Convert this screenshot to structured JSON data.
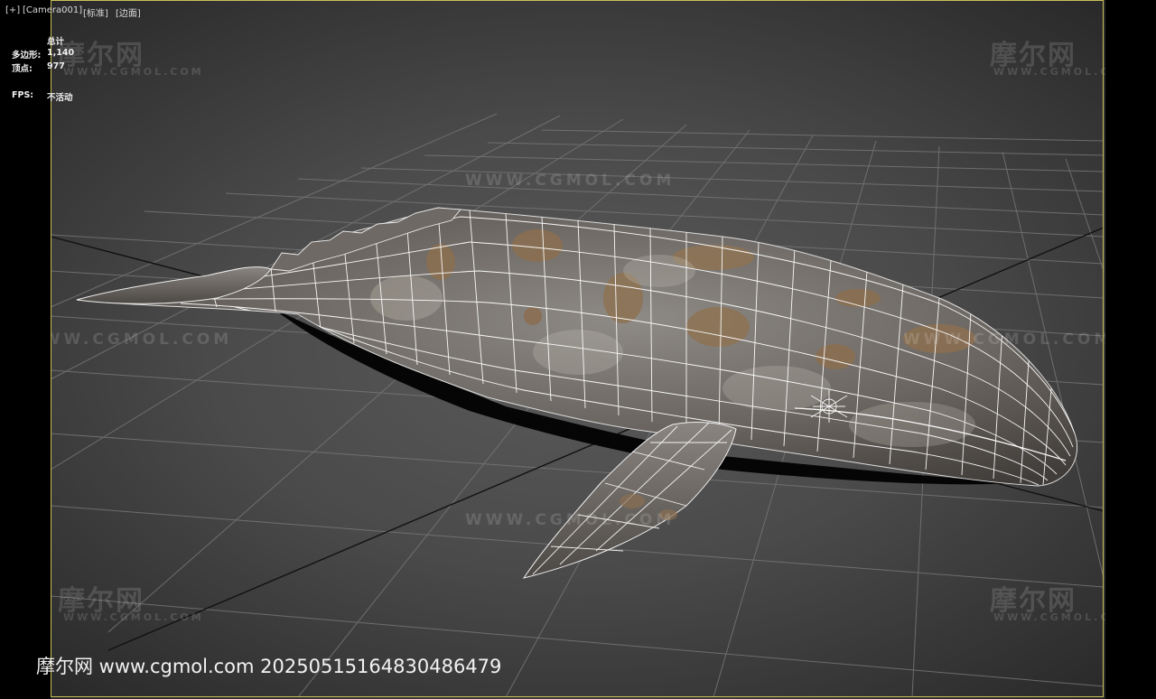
{
  "viewport": {
    "labels": [
      "[+]",
      "[Camera001]",
      "[标准]",
      "[边面]"
    ]
  },
  "stats": {
    "total_label": "总计",
    "polygons_label": "多边形:",
    "polygons_value": "1,140",
    "vertices_label": "顶点:",
    "vertices_value": "977",
    "fps_label": "FPS:",
    "fps_value": "不活动"
  },
  "watermark": {
    "logo": "摩尔网",
    "sub": "WWW.CGMOL.COM",
    "url": "WWW.CGMOL.COM"
  },
  "footer": {
    "text": "摩尔网 www.cgmol.com 20250515164830486479"
  },
  "colors": {
    "frame": "#c8c05a",
    "background": "#4a4a4a",
    "grid": "#7a7a7a",
    "wire": "#ffffff"
  },
  "icons": [
    "axis-gizmo-icon"
  ]
}
